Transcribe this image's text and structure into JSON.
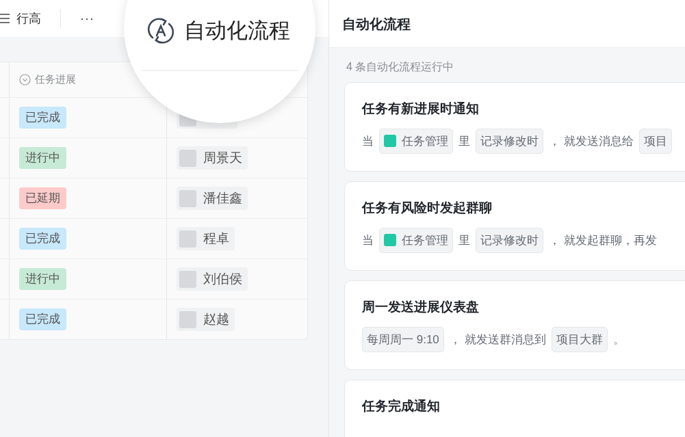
{
  "toolbar": {
    "row_height_label": "行高",
    "more": "···"
  },
  "magnifier": {
    "label": "自动化流程"
  },
  "table": {
    "columns": [
      {
        "label": "任务进展"
      }
    ],
    "rows": [
      {
        "status": "已完成",
        "kind": "done"
      },
      {
        "status": "进行中",
        "kind": "doing",
        "assignee": "周景天"
      },
      {
        "status": "已延期",
        "kind": "delayed",
        "assignee": "潘佳鑫"
      },
      {
        "status": "已完成",
        "kind": "done",
        "assignee": "程卓"
      },
      {
        "status": "进行中",
        "kind": "doing",
        "assignee": "刘伯侯"
      },
      {
        "status": "已完成",
        "kind": "done",
        "assignee": "赵越"
      }
    ]
  },
  "panel": {
    "title": "自动化流程",
    "summary": "4 条自动化流程运行中",
    "flows": [
      {
        "title": "任务有新进展时通知",
        "parts": [
          {
            "kind": "text",
            "text": "当"
          },
          {
            "kind": "app",
            "text": "任务管理"
          },
          {
            "kind": "text",
            "text": "里"
          },
          {
            "kind": "chip",
            "text": "记录修改时"
          },
          {
            "kind": "text",
            "text": "， 就发送消息给"
          },
          {
            "kind": "chip",
            "text": "项目"
          }
        ]
      },
      {
        "title": "任务有风险时发起群聊",
        "parts": [
          {
            "kind": "text",
            "text": "当"
          },
          {
            "kind": "app",
            "text": "任务管理"
          },
          {
            "kind": "text",
            "text": "里"
          },
          {
            "kind": "chip",
            "text": "记录修改时"
          },
          {
            "kind": "text",
            "text": "， 就发起群聊，再发"
          }
        ]
      },
      {
        "title": "周一发送进展仪表盘",
        "parts": [
          {
            "kind": "chip",
            "text": "每周周一 9:10"
          },
          {
            "kind": "text",
            "text": "， 就发送群消息到"
          },
          {
            "kind": "chip",
            "text": "项目大群"
          },
          {
            "kind": "text",
            "text": "。"
          }
        ]
      },
      {
        "title": "任务完成通知"
      }
    ]
  }
}
